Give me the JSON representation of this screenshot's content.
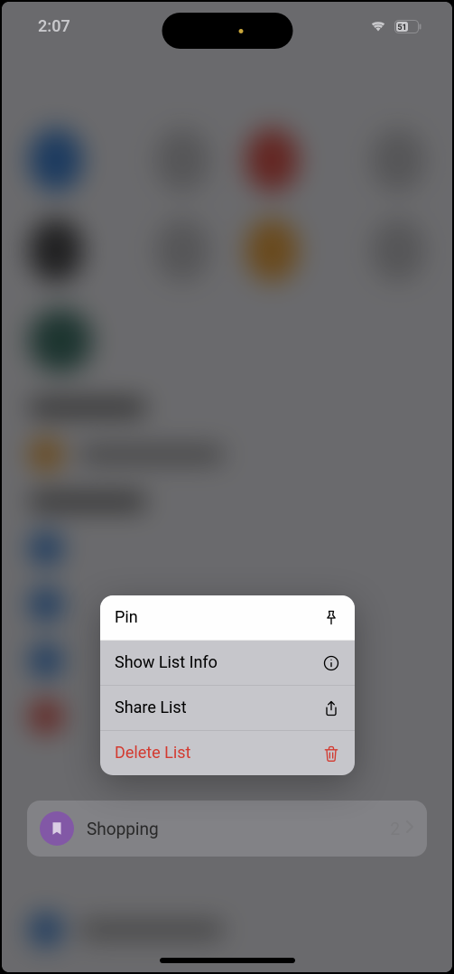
{
  "status": {
    "time": "2:07",
    "battery_text": "51"
  },
  "context_menu": {
    "items": [
      {
        "label": "Pin",
        "icon": "pin-icon",
        "highlighted": true,
        "destructive": false
      },
      {
        "label": "Show List Info",
        "icon": "info-icon",
        "highlighted": false,
        "destructive": false
      },
      {
        "label": "Share List",
        "icon": "share-icon",
        "highlighted": false,
        "destructive": false
      },
      {
        "label": "Delete List",
        "icon": "trash-icon",
        "highlighted": false,
        "destructive": true
      }
    ]
  },
  "list_row": {
    "title": "Shopping",
    "count": "2",
    "icon": "bookmark-icon",
    "color": "#8e44ad"
  }
}
